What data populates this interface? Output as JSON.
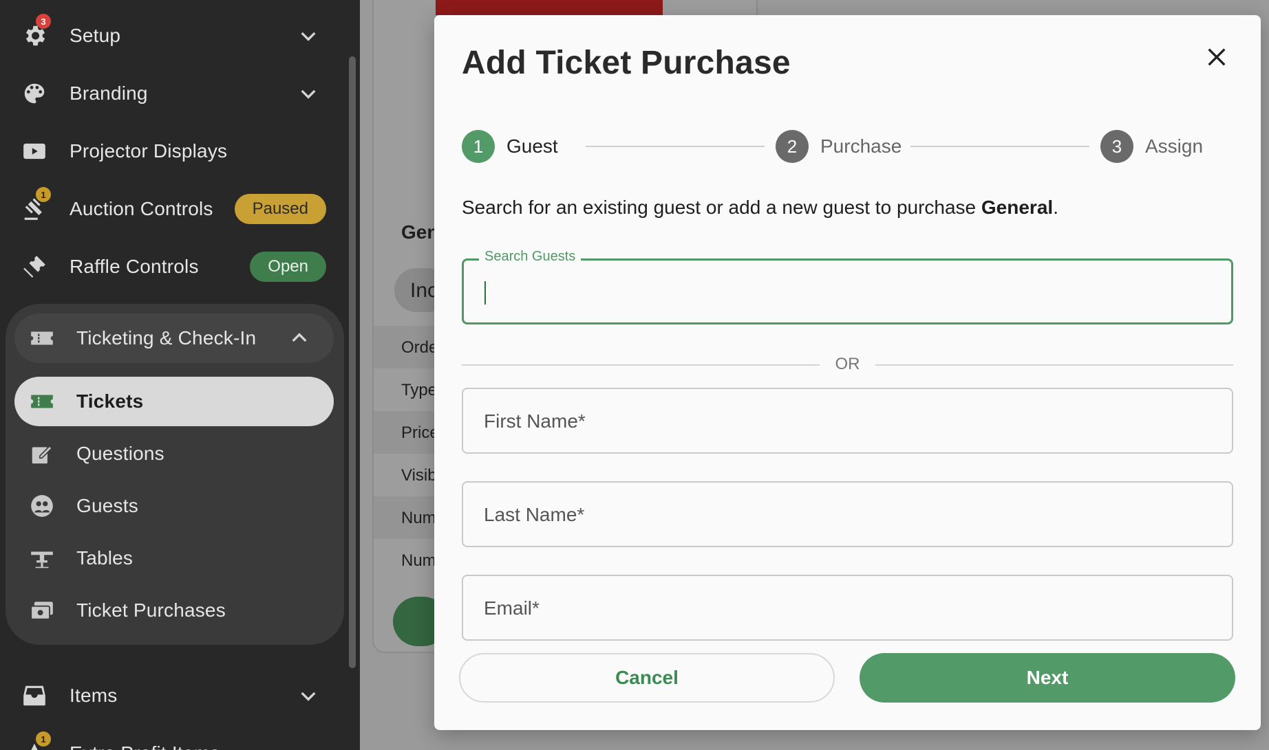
{
  "sidebar": {
    "items": [
      {
        "label": "Setup",
        "icon": "gear-icon",
        "badge": "3"
      },
      {
        "label": "Branding",
        "icon": "palette-icon"
      },
      {
        "label": "Projector Displays",
        "icon": "play-screen-icon"
      },
      {
        "label": "Auction Controls",
        "icon": "gavel-icon",
        "badge": "1",
        "status": "Paused"
      },
      {
        "label": "Raffle Controls",
        "icon": "ticket-icon",
        "status": "Open"
      }
    ],
    "group": {
      "label": "Ticketing & Check-In",
      "icon": "ticket-stub-icon",
      "subitems": [
        {
          "label": "Tickets",
          "icon": "ticket-stub-icon",
          "active": true
        },
        {
          "label": "Questions",
          "icon": "edit-note-icon"
        },
        {
          "label": "Guests",
          "icon": "guests-icon"
        },
        {
          "label": "Tables",
          "icon": "table-icon"
        },
        {
          "label": "Ticket Purchases",
          "icon": "purchases-icon"
        }
      ]
    },
    "items_after": [
      {
        "label": "Items",
        "icon": "inbox-icon"
      },
      {
        "label": "Extra Profit Items",
        "icon": "profit-icon",
        "badge": "1"
      }
    ]
  },
  "background": {
    "heading_fragment": "Gen",
    "chip_fragment": "Inc",
    "rows": [
      "Orde",
      "Type",
      "Price",
      "Visib",
      "Num",
      "Num"
    ]
  },
  "modal": {
    "title": "Add Ticket Purchase",
    "steps": [
      {
        "number": "1",
        "label": "Guest",
        "state": "active"
      },
      {
        "number": "2",
        "label": "Purchase",
        "state": "inactive"
      },
      {
        "number": "3",
        "label": "Assign",
        "state": "inactive"
      }
    ],
    "instructions_prefix": "Search for an existing guest or add a new guest to purchase ",
    "instructions_bold": "General",
    "instructions_suffix": ".",
    "search": {
      "label": "Search Guests",
      "value": ""
    },
    "or_text": "OR",
    "fields": {
      "first_name_placeholder": "First Name*",
      "last_name_placeholder": "Last Name*",
      "email_placeholder": "Email*"
    },
    "cancel_label": "Cancel",
    "next_label": "Next"
  },
  "colors": {
    "accent_green": "#539a69",
    "step_active": "#539a69",
    "step_inactive": "#6a6a6a",
    "paused": "#c9a033",
    "open": "#3f7d4c",
    "sidebar_bg": "#282828"
  }
}
